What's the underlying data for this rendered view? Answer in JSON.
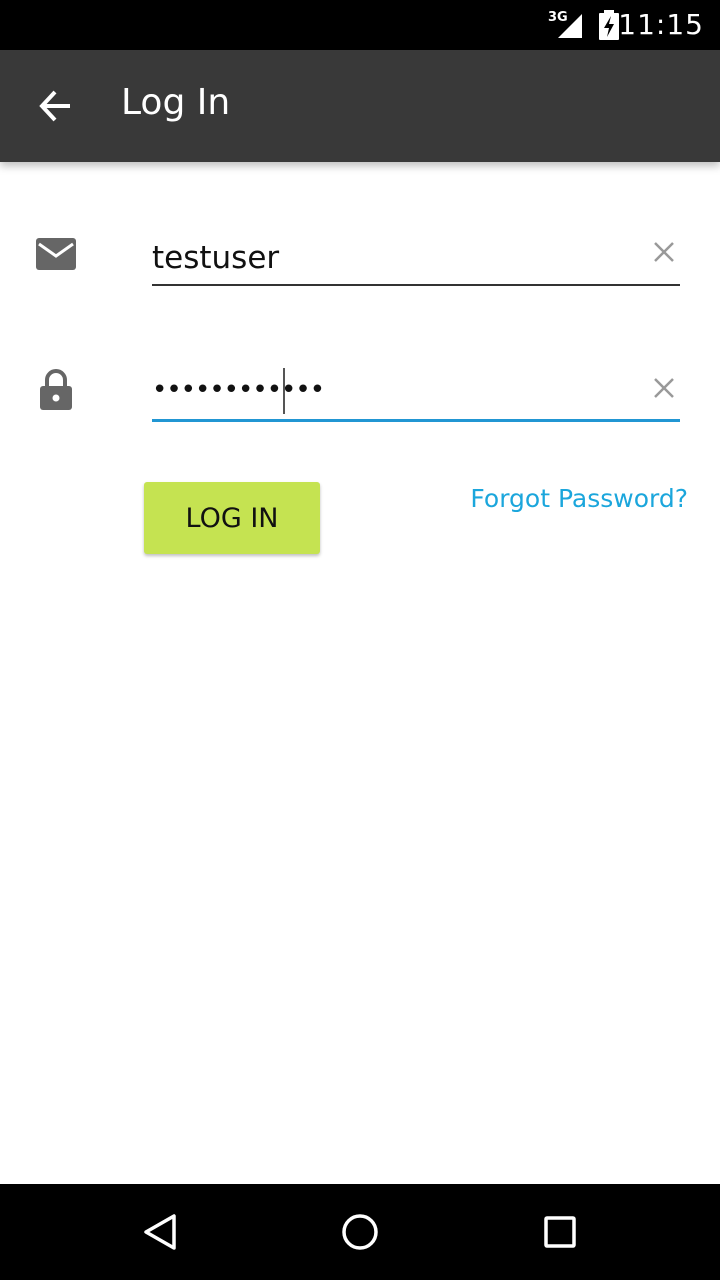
{
  "status_bar": {
    "network": "3G",
    "time": "11:15"
  },
  "app_bar": {
    "title": "Log In",
    "back_icon": "arrow-left-icon"
  },
  "form": {
    "email": {
      "icon": "mail-icon",
      "value": "testuser",
      "clear_icon": "close-icon"
    },
    "password": {
      "icon": "lock-icon",
      "value": "••••••••••••",
      "clear_icon": "close-icon",
      "focused": true
    },
    "login_label": "LOG IN",
    "forgot_label": "Forgot Password?"
  },
  "colors": {
    "app_bar": "#393939",
    "accent_button": "#c5e351",
    "link": "#1ba6dc",
    "focus_underline": "#2196d3"
  },
  "nav_bar": {
    "back_icon": "triangle-back-icon",
    "home_icon": "circle-home-icon",
    "recents_icon": "square-recents-icon"
  }
}
